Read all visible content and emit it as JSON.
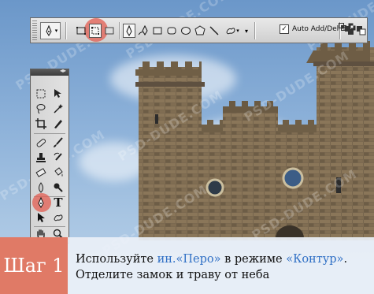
{
  "optbar": {
    "auto_add_label": "Auto Add/Delete",
    "auto_add_checked": "✓"
  },
  "tools": {
    "header_glyph": "◂▸",
    "type_tool_label": "T"
  },
  "watermark": "PSD-DUDE.COM",
  "banner": {
    "step": "Шаг 1",
    "line1_a": "Используйте ",
    "line1_b": "ин.«Перо»",
    "line1_c": " в режиме ",
    "line1_d": "«Контур»",
    "line1_e": ".",
    "line2": "Отделите замок и траву от неба"
  },
  "colors": {
    "highlight": "#e25c50",
    "step_box": "#e07a66",
    "accent_text": "#2f6fc5",
    "stone": "#7a6a52"
  }
}
